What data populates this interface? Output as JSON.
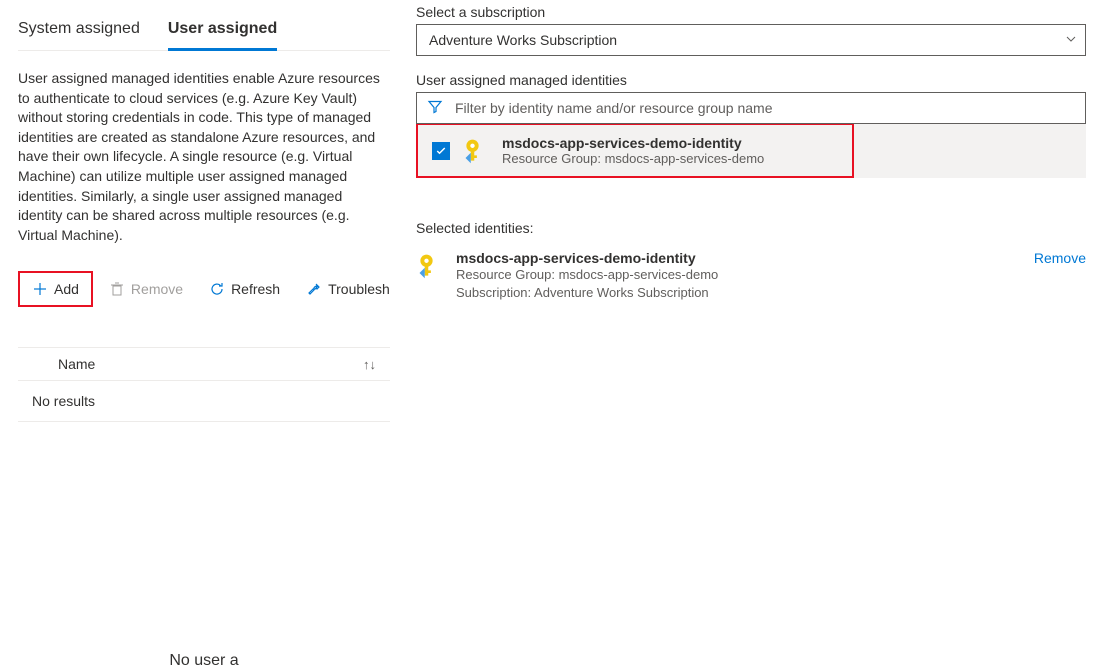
{
  "tabs": {
    "system": "System assigned",
    "user": "User assigned"
  },
  "description": "User assigned managed identities enable Azure resources to authenticate to cloud services (e.g. Azure Key Vault) without storing credentials in code. This type of managed identities are created as standalone Azure resources, and have their own lifecycle. A single resource (e.g. Virtual Machine) can utilize multiple user assigned managed identities. Similarly, a single user assigned managed identity can be shared across multiple resources (e.g. Virtual Machine).",
  "toolbar": {
    "add": "Add",
    "remove": "Remove",
    "refresh": "Refresh",
    "troubleshoot": "Troubleshoot"
  },
  "table": {
    "name_header": "Name",
    "no_results": "No results",
    "no_user": "No user assigned managed identities found on this resource."
  },
  "right": {
    "subscription_label": "Select a subscription",
    "subscription_value": "Adventure Works Subscription",
    "identities_label": "User assigned managed identities",
    "filter_placeholder": "Filter by identity name and/or resource group name",
    "identity": {
      "name": "msdocs-app-services-demo-identity",
      "rg_label": "Resource Group: msdocs-app-services-demo"
    },
    "selected_label": "Selected identities:",
    "selected": {
      "name": "msdocs-app-services-demo-identity",
      "rg": "Resource Group: msdocs-app-services-demo",
      "sub": "Subscription: Adventure Works Subscription",
      "remove": "Remove"
    }
  }
}
